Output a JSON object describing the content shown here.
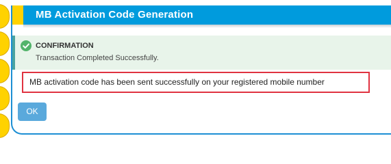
{
  "dialog": {
    "title": "MB Activation Code Generation"
  },
  "confirmation": {
    "heading": "CONFIRMATION",
    "message": "Transaction Completed Successfully.",
    "icon": "check-circle-icon",
    "color": "#53b46b"
  },
  "notice": {
    "text": "MB activation code has been sent successfully on your registered mobile number",
    "border_color": "#e03240"
  },
  "actions": {
    "ok_label": "OK"
  },
  "colors": {
    "title_bar": "#009bdd",
    "side_accent": "#ffd200",
    "alert_background": "#e8f4ea",
    "button": "#5aa9dc"
  }
}
